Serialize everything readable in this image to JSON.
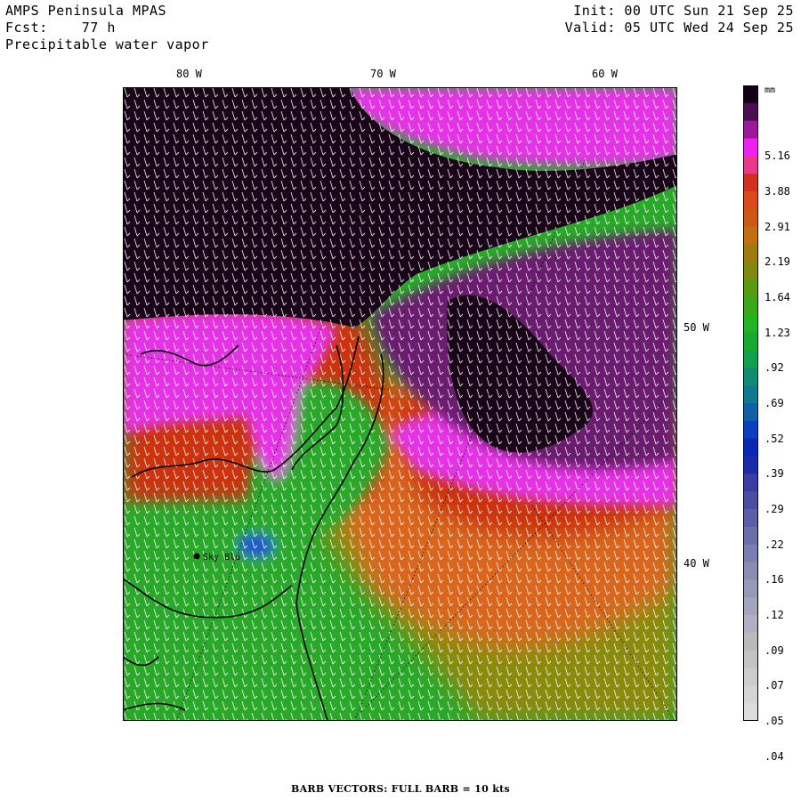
{
  "header": {
    "model": "AMPS Peninsula MPAS",
    "forecast": "Fcst:    77 h",
    "field": "Precipitable water vapor",
    "init": "Init: 00 UTC Sun 21 Sep 25",
    "valid": "Valid: 05 UTC Wed 24 Sep 25"
  },
  "map": {
    "lon_labels": [
      "80 W",
      "70 W",
      "60 W"
    ],
    "lat_labels": [
      "50 W",
      "40 W"
    ],
    "station": "Sky Blu",
    "colors": {
      "dark": "#1a0418",
      "purple": "#6a1a6e",
      "magenta": "#e632e6",
      "red": "#cc3311",
      "orange": "#d9661a",
      "olive": "#8a8a10",
      "green": "#2aa82a",
      "blue": "#2255cc"
    }
  },
  "legend": {
    "unit": "mm",
    "labels": [
      "5.16",
      "3.88",
      "2.91",
      "2.19",
      "1.64",
      "1.23",
      ".92",
      ".69",
      ".52",
      ".39",
      ".29",
      ".22",
      ".16",
      ".12",
      ".09",
      ".07",
      ".05",
      ".04"
    ],
    "colors": [
      "#140014",
      "#4a0f4e",
      "#9a1a9a",
      "#ee22ee",
      "#e83a88",
      "#d2301e",
      "#d84a1a",
      "#cc5a14",
      "#c07010",
      "#a07a0c",
      "#808a0c",
      "#5a9a10",
      "#3aa81a",
      "#22b422",
      "#1aa830",
      "#10a050",
      "#108a70",
      "#107890",
      "#1060a8",
      "#0a40c0",
      "#0a28b4",
      "#1a2aa8",
      "#3a3ea0",
      "#4a4ea0",
      "#5a5ea4",
      "#6a6eaa",
      "#7a7eb0",
      "#8a8cb4",
      "#9898b8",
      "#a4a4bc",
      "#b0b0c0",
      "#bababa",
      "#c4c4c4",
      "#cccccc",
      "#d4d4d4",
      "#dcdcdc"
    ]
  },
  "footer": "BARB VECTORS:  FULL BARB = 10 kts"
}
